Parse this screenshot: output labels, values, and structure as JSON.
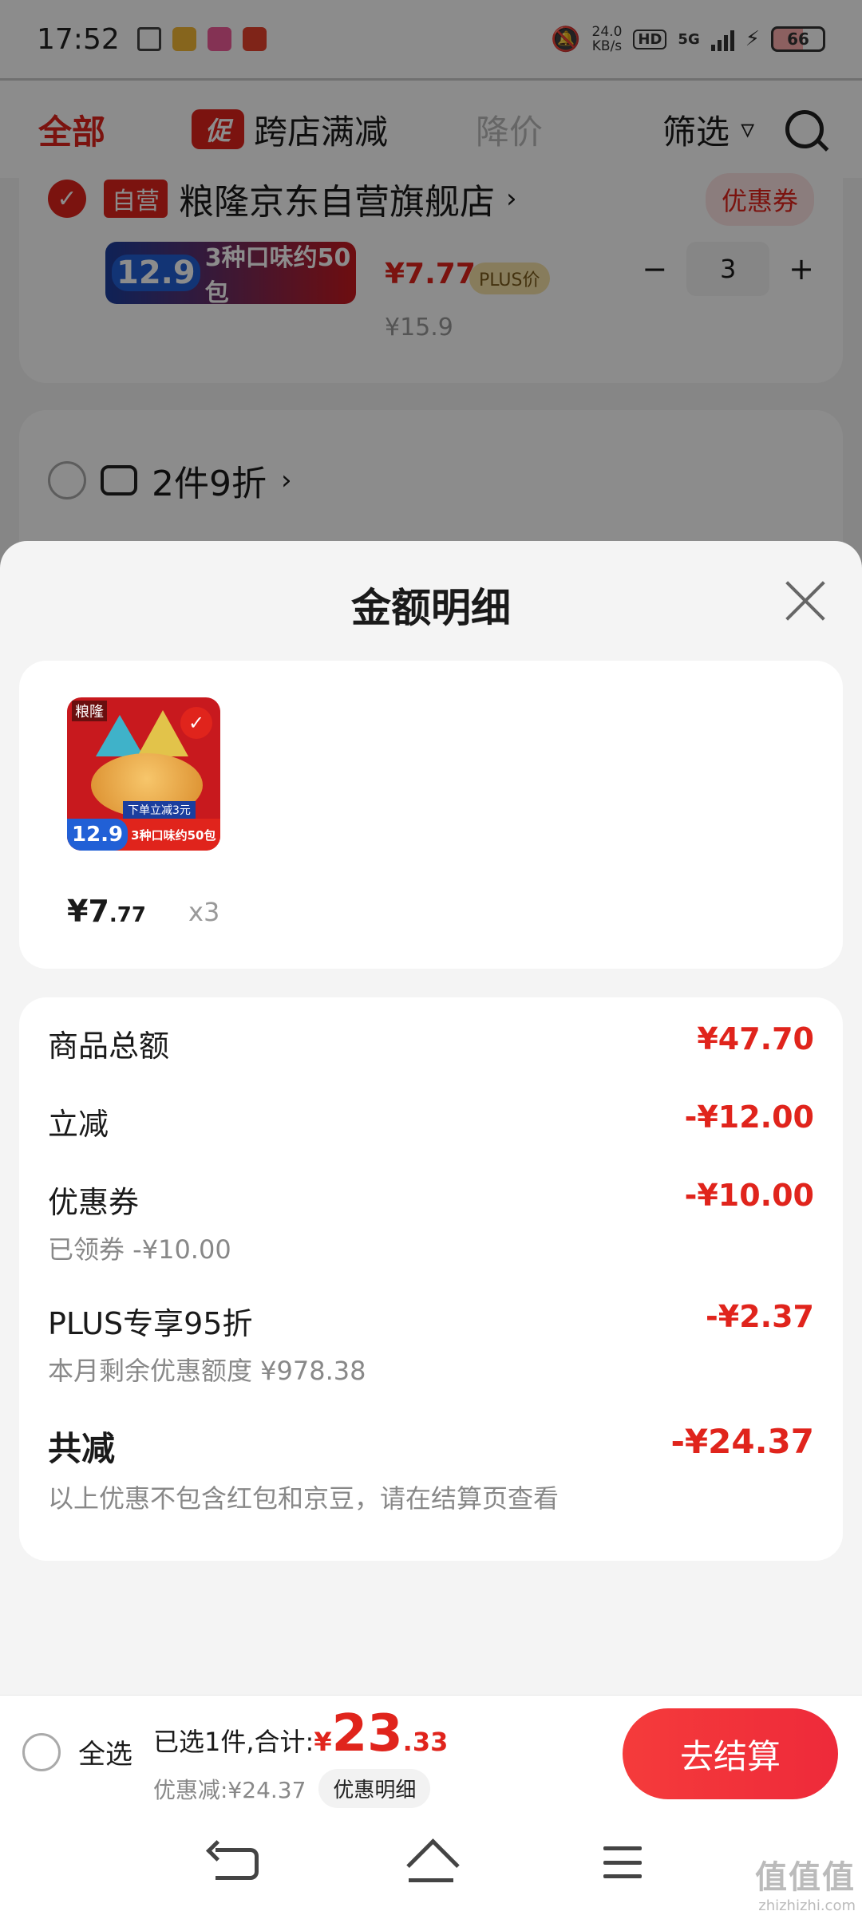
{
  "status_bar": {
    "time": "17:52",
    "net_speed_value": "24.0",
    "net_speed_unit": "KB/s",
    "hd": "HD",
    "network": "5G",
    "battery": "66"
  },
  "tabs": {
    "all": "全部",
    "promo_badge": "促",
    "cross_store": "跨店满减",
    "price_drop": "降价",
    "filter": "筛选"
  },
  "background_cart": {
    "store_tag": "自营",
    "store_name": "粮隆京东自营旗舰店",
    "coupon_button": "优惠券",
    "banner_price": "12.9",
    "banner_text": "3种口味约50包",
    "banner_top": "下单立减3元",
    "price": "¥7.77",
    "plus_tag": "PLUS价",
    "original_price": "¥15.9",
    "quantity": "3",
    "minus": "−",
    "plus": "+",
    "promo_group": "2件9折"
  },
  "sheet": {
    "title": "金额明细",
    "product": {
      "brand_mark": "粮隆",
      "img_price": "12.9",
      "img_text": "3种口味约50包",
      "img_promo": "下单立减3元",
      "price_main": "¥7",
      "price_decimal": ".77",
      "quantity": "x3"
    },
    "details": {
      "goods_total_label": "商品总额",
      "goods_total_value": "¥47.70",
      "instant_off_label": "立减",
      "instant_off_value": "-¥12.00",
      "coupon_label": "优惠券",
      "coupon_sub": "已领券 -¥10.00",
      "coupon_value": "-¥10.00",
      "plus_label": "PLUS专享95折",
      "plus_sub": "本月剩余优惠额度 ¥978.38",
      "plus_value": "-¥2.37",
      "total_label": "共减",
      "total_sub": "以上优惠不包含红包和京豆，请在结算页查看",
      "total_value": "-¥24.37"
    }
  },
  "bottom_bar": {
    "select_all": "全选",
    "selected_text": "已选1件,合计:",
    "sum_yen": "¥",
    "sum_int": "23",
    "sum_dec": ".33",
    "discount_text": "优惠减:¥24.37",
    "detail_button": "优惠明细",
    "checkout": "去结算"
  },
  "watermark": {
    "mark": "值值值",
    "url": "zhizhizhi.com"
  },
  "colors": {
    "accent": "#e0241c",
    "checkout_button": "#f53b3b",
    "sheet_bg": "#f4f4f4"
  }
}
